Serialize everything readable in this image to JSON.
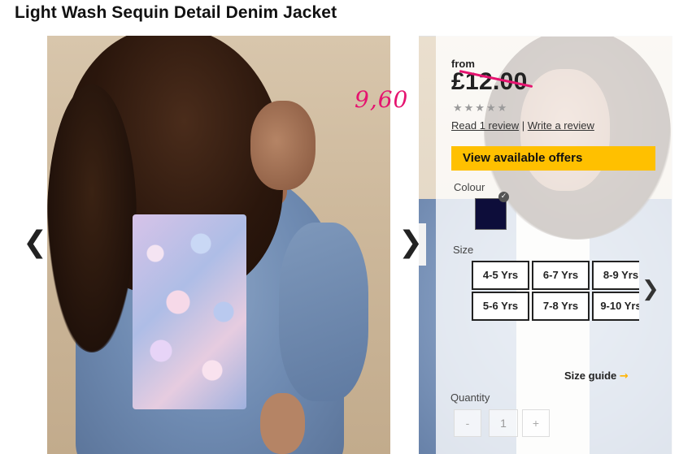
{
  "product": {
    "title": "Light Wash Sequin Detail Denim Jacket",
    "price_prefix": "from",
    "price": "£12.00",
    "handwritten_price": "9,60",
    "rating_stars": "★★★★★",
    "read_reviews_link": "Read 1 review",
    "review_separator": "|",
    "write_review_link": "Write a review",
    "offers_button": "View available offers",
    "colour_label": "Colour",
    "selected_colour": "#0d0d3a",
    "size_label": "Size",
    "sizes": [
      "4-5 Yrs",
      "6-7 Yrs",
      "8-9 Yrs",
      "5-6 Yrs",
      "7-8 Yrs",
      "9-10 Yrs"
    ],
    "size_guide": "Size guide",
    "quantity_label": "Quantity",
    "quantity_value": "1",
    "qty_minus": "-",
    "qty_plus": "+"
  },
  "gallery": {
    "prev_arrow": "❮",
    "next_arrow": "❯",
    "sizes_next_arrow": "❯",
    "size_guide_arrow": "→",
    "selected_tick": "✓"
  },
  "colors": {
    "offers_yellow": "#ffc000",
    "annotation_pink": "#e5136f"
  }
}
